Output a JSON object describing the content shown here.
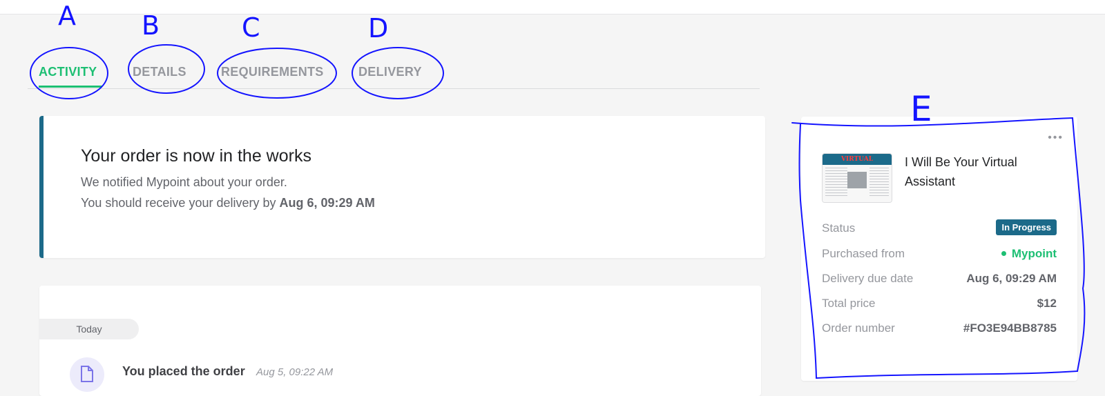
{
  "tabs": [
    {
      "label": "ACTIVITY",
      "active": true
    },
    {
      "label": "DETAILS",
      "active": false
    },
    {
      "label": "REQUIREMENTS",
      "active": false
    },
    {
      "label": "DELIVERY",
      "active": false
    }
  ],
  "annotations": {
    "a": "A",
    "b": "B",
    "c": "C",
    "d": "D",
    "e": "E"
  },
  "order_status": {
    "title": "Your order is now in the works",
    "line1": "We notified Mypoint about your order.",
    "line2_prefix": "You should receive your delivery by ",
    "line2_date": "Aug 6, 09:29 AM"
  },
  "timeline": {
    "day_label": "Today",
    "event_label": "You placed the order",
    "event_time": "Aug 5, 09:22 AM",
    "event_icon": "document-icon"
  },
  "summary": {
    "more_icon": "•••",
    "thumbnail_text": "VIRTUAL ASSISTANCE",
    "gig_title": "I Will Be Your Virtual Assistant",
    "status_label": "Status",
    "status_value": "In Progress",
    "purchased_from_label": "Purchased from",
    "purchased_from_value": "Mypoint",
    "due_label": "Delivery due date",
    "due_value": "Aug 6, 09:29 AM",
    "price_label": "Total price",
    "price_value": "$12",
    "order_number_label": "Order number",
    "order_number_value": "#FO3E94BB8785"
  },
  "colors": {
    "accent_green": "#1dbf73",
    "status_blue": "#1c6a89",
    "annotation_blue": "#1414ff"
  }
}
